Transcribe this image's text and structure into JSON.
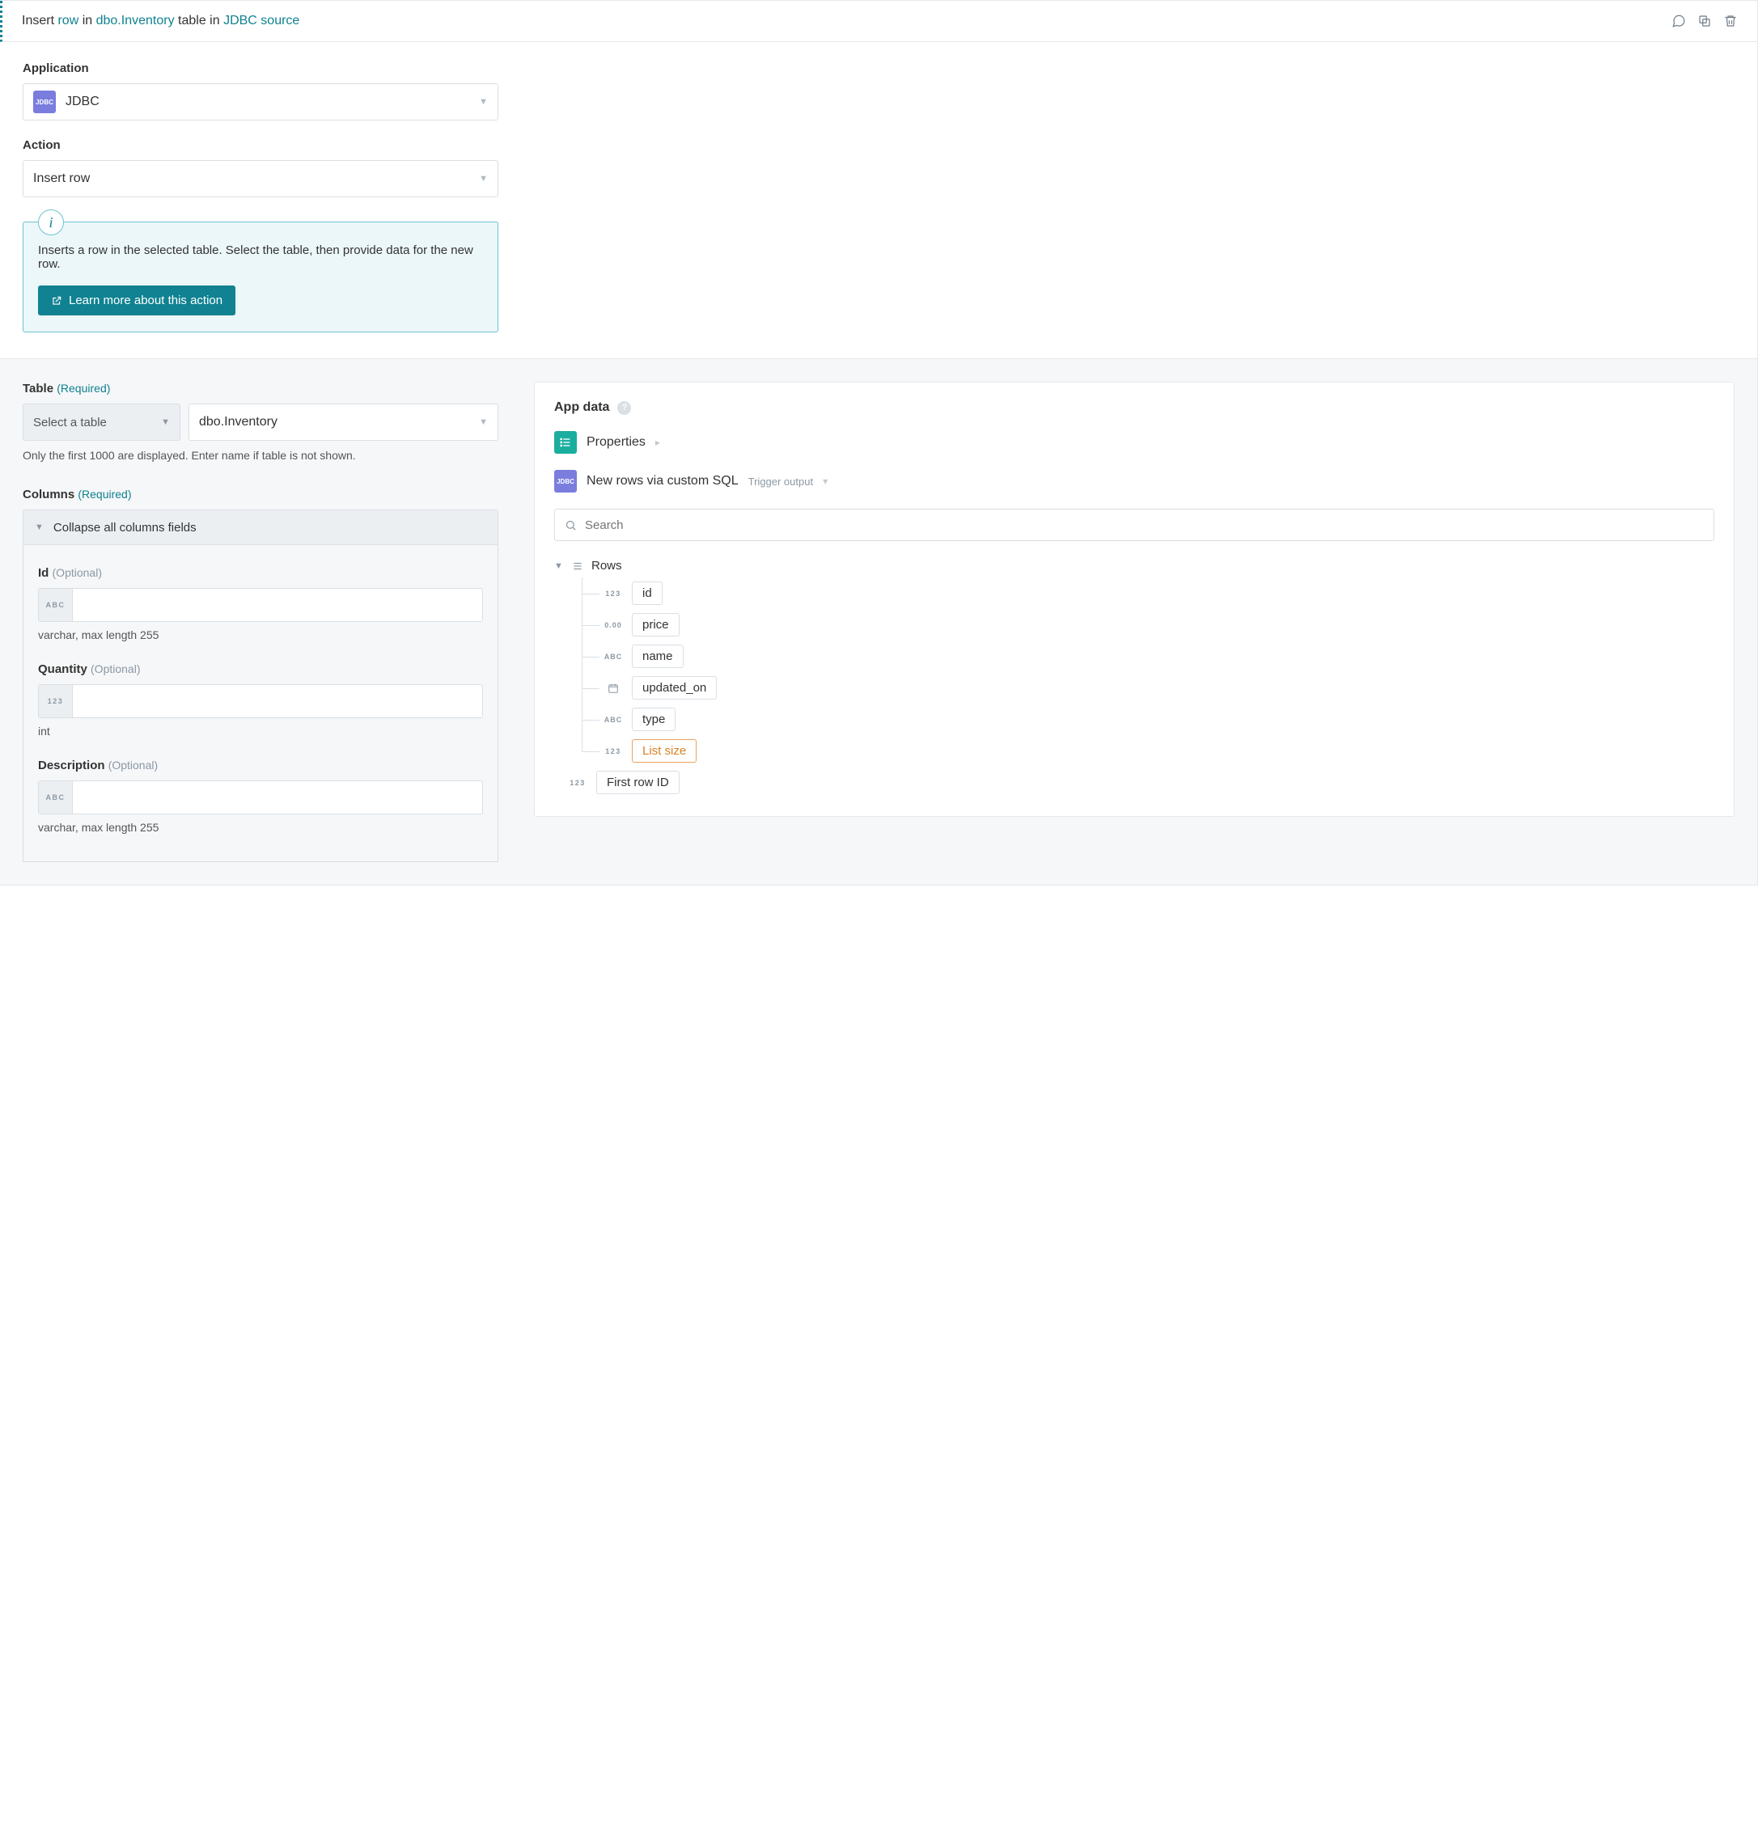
{
  "header": {
    "prefix": "Insert",
    "hl1": "row",
    "mid1": "in",
    "hl2": "dbo.Inventory",
    "mid2": "table in",
    "hl3": "JDBC source"
  },
  "top": {
    "application_label": "Application",
    "application_value": "JDBC",
    "action_label": "Action",
    "action_value": "Insert row",
    "info_text": "Inserts a row in the selected table. Select the table, then provide data for the new row.",
    "learn_more": "Learn more about this action"
  },
  "table_section": {
    "label": "Table",
    "required": "(Required)",
    "select_label": "Select a table",
    "value": "dbo.Inventory",
    "hint": "Only the first 1000 are displayed. Enter name if table is not shown."
  },
  "columns_section": {
    "label": "Columns",
    "required": "(Required)",
    "collapse_label": "Collapse all columns fields",
    "fields": [
      {
        "name": "Id",
        "type_chip": "ABC",
        "type_hint": "varchar, max length 255"
      },
      {
        "name": "Quantity",
        "type_chip": "123",
        "type_hint": "int"
      },
      {
        "name": "Description",
        "type_chip": "ABC",
        "type_hint": "varchar, max length 255"
      }
    ],
    "optional_label": "(Optional)"
  },
  "app_data": {
    "title": "App data",
    "sources": {
      "properties": "Properties",
      "new_rows": "New rows via custom SQL",
      "trigger_output": "Trigger output"
    },
    "search_placeholder": "Search",
    "rows_label": "Rows",
    "pills": [
      {
        "type": "123",
        "label": "id"
      },
      {
        "type": "0.00",
        "label": "price"
      },
      {
        "type": "ABC",
        "label": "name"
      },
      {
        "type": "date",
        "label": "updated_on"
      },
      {
        "type": "ABC",
        "label": "type"
      },
      {
        "type": "123",
        "label": "List size",
        "orange": true
      }
    ],
    "bottom_pill": {
      "type": "123",
      "label": "First row ID"
    }
  }
}
